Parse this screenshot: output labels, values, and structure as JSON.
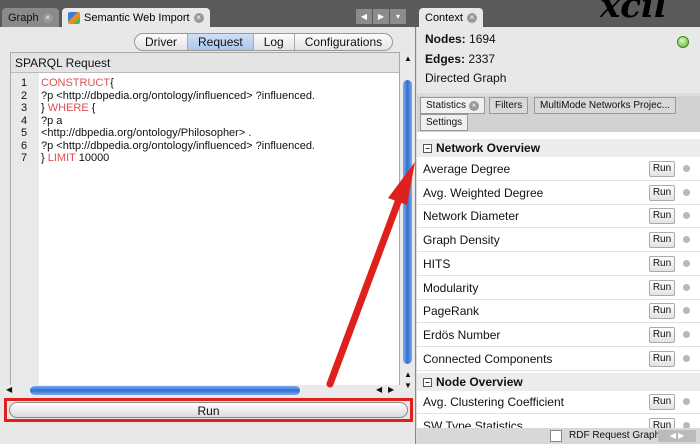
{
  "tabs": {
    "graph": "Graph",
    "semantic": "Semantic Web Import",
    "context": "Context"
  },
  "subtabs": [
    "Driver",
    "Request",
    "Log",
    "Configurations"
  ],
  "sparql": {
    "title": "SPARQL Request",
    "lines": [
      {
        "n": "1",
        "kw": "CONSTRUCT",
        "text": "{"
      },
      {
        "n": "2",
        "kw": "",
        "text": "?p <http://dbpedia.org/ontology/influenced> ?influenced."
      },
      {
        "n": "3",
        "kw": "WHERE",
        "pre": "} ",
        "text": " {"
      },
      {
        "n": "4",
        "kw": "",
        "text": "  ?p a"
      },
      {
        "n": "5",
        "kw": "",
        "text": "<http://dbpedia.org/ontology/Philosopher> ."
      },
      {
        "n": "6",
        "kw": "",
        "text": "?p <http://dbpedia.org/ontology/influenced> ?influenced."
      },
      {
        "n": "7",
        "kw": "LIMIT",
        "pre": "} ",
        "text": " 10000"
      }
    ]
  },
  "run_label": "Run",
  "context": {
    "nodes_label": "Nodes:",
    "nodes": "1694",
    "edges_label": "Edges:",
    "edges": "2337",
    "graph_type": "Directed Graph"
  },
  "stat_tabs": [
    "Statistics",
    "Filters",
    "MultiMode Networks Projec...",
    "Settings"
  ],
  "network_overview": {
    "title": "Network Overview",
    "items": [
      "Average Degree",
      "Avg. Weighted Degree",
      "Network Diameter",
      "Graph Density",
      "HITS",
      "Modularity",
      "PageRank",
      "Erdös Number",
      "Connected Components"
    ]
  },
  "node_overview": {
    "title": "Node Overview",
    "items": [
      "Avg. Clustering Coefficient",
      "SW Type Statistics"
    ]
  },
  "row_button": "Run",
  "bottom": {
    "rdf_label": "RDF Request Graph"
  },
  "corner_text": "xcil"
}
